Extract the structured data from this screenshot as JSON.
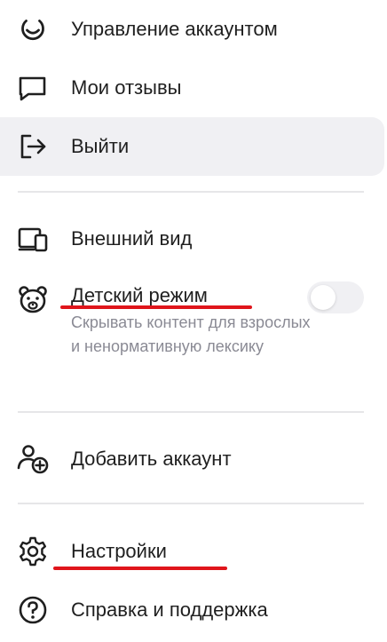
{
  "menu": {
    "items": [
      {
        "label": "Управление аккаунтом",
        "icon": "account-manage-icon"
      },
      {
        "label": "Мои отзывы",
        "icon": "reviews-icon"
      },
      {
        "label": "Выйти",
        "icon": "logout-icon"
      },
      {
        "label": "Внешний вид",
        "icon": "appearance-icon"
      },
      {
        "label": "Детский режим",
        "icon": "bear-icon",
        "description": "Скрывать контент для взрослых и ненормативную лексику",
        "toggle_on": false
      },
      {
        "label": "Добавить аккаунт",
        "icon": "add-account-icon"
      },
      {
        "label": "Настройки",
        "icon": "gear-icon"
      },
      {
        "label": "Справка и поддержка",
        "icon": "help-icon"
      }
    ]
  },
  "colors": {
    "text": "#1f1f1f",
    "secondary_text": "#8a8a94",
    "hover_background": "#f0f0f3",
    "divider": "#e6e6e8",
    "annotation_underline": "#e0151b"
  }
}
